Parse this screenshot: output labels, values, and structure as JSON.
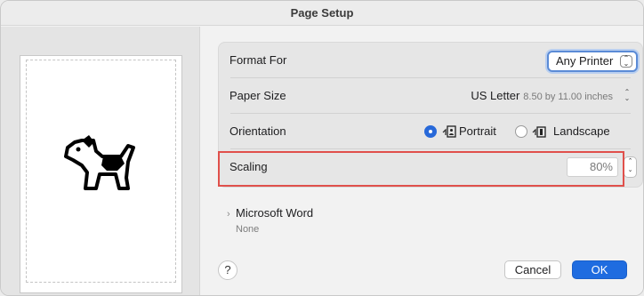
{
  "window": {
    "title": "Page Setup"
  },
  "settings": {
    "format_for": {
      "label": "Format For",
      "value": "Any Printer"
    },
    "paper_size": {
      "label": "Paper Size",
      "value": "US Letter",
      "dimensions": "8.50 by 11.00 inches"
    },
    "orientation": {
      "label": "Orientation",
      "portrait": "Portrait",
      "landscape": "Landscape",
      "selected": "Portrait"
    },
    "scaling": {
      "label": "Scaling",
      "value": "80%"
    }
  },
  "section": {
    "title": "Microsoft Word",
    "subtitle": "None"
  },
  "buttons": {
    "help": "?",
    "cancel": "Cancel",
    "ok": "OK"
  },
  "icons": {
    "preview": "dog-icon",
    "popup": "updown-chevrons-icon",
    "portrait": "portrait-icon",
    "landscape": "landscape-icon",
    "disclosure": "chevron-right-icon"
  },
  "colors": {
    "accent": "#1f6ce0",
    "highlight": "#e0504b"
  }
}
